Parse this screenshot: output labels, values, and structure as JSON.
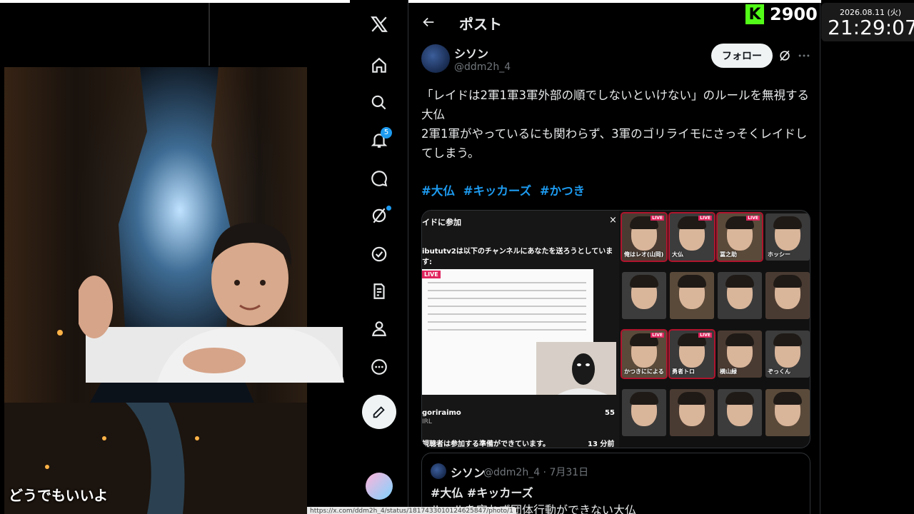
{
  "overlay": {
    "caption": "どうでもいいよ",
    "counter_value": "2900",
    "date": "2026.08.11 (火)",
    "time": "21:29:07"
  },
  "nav": {
    "notification_count": "5"
  },
  "post": {
    "header_title": "ポスト",
    "author_name": "シソン",
    "author_handle": "@ddm2h_4",
    "follow_label": "フォロー",
    "body_lines": [
      "「レイドは2軍1軍3軍外部の順でしないといけない」のルールを無視する",
      "大仏",
      "2軍1軍がやっているにも関わらず、3軍のゴリライモにさっそくレイドし",
      "てしまう。"
    ],
    "hashtags": [
      "#大仏",
      "#キッカーズ",
      "#かつき"
    ]
  },
  "media": {
    "title": "イドに参加",
    "close": "×",
    "subtitle": "ibututv2は以下のチャンネルにあなたを送ろうとしています:",
    "live_label": "LIVE",
    "channel": "goriraimo",
    "channel_sub": "IRL",
    "count": "55",
    "footer": "視聴者は参加する準備ができています。",
    "footer_time": "13 分前開",
    "tiles": [
      {
        "name": "俺はレオ(山岡)",
        "live": true
      },
      {
        "name": "大仏",
        "live": true
      },
      {
        "name": "冨之助",
        "live": true
      },
      {
        "name": "ホッシー",
        "live": false
      },
      {
        "name": "",
        "live": false
      },
      {
        "name": "",
        "live": false
      },
      {
        "name": "",
        "live": false
      },
      {
        "name": "",
        "live": false
      },
      {
        "name": "かつきにによる",
        "live": true
      },
      {
        "name": "勇者トロ",
        "live": true
      },
      {
        "name": "横山緑",
        "live": false
      },
      {
        "name": "ぞっくん",
        "live": false
      },
      {
        "name": "",
        "live": false
      },
      {
        "name": "",
        "live": false
      },
      {
        "name": "",
        "live": false
      },
      {
        "name": "",
        "live": false
      }
    ]
  },
  "quote": {
    "name": "シソン",
    "handle": "@ddm2h_4 · 7月31日",
    "tags": "#大仏 #キッカーズ",
    "text": "ルールを守れず団体行動ができない大仏"
  },
  "status_url": "https://x.com/ddm2h_4/status/1817433010124625847/photo/1"
}
